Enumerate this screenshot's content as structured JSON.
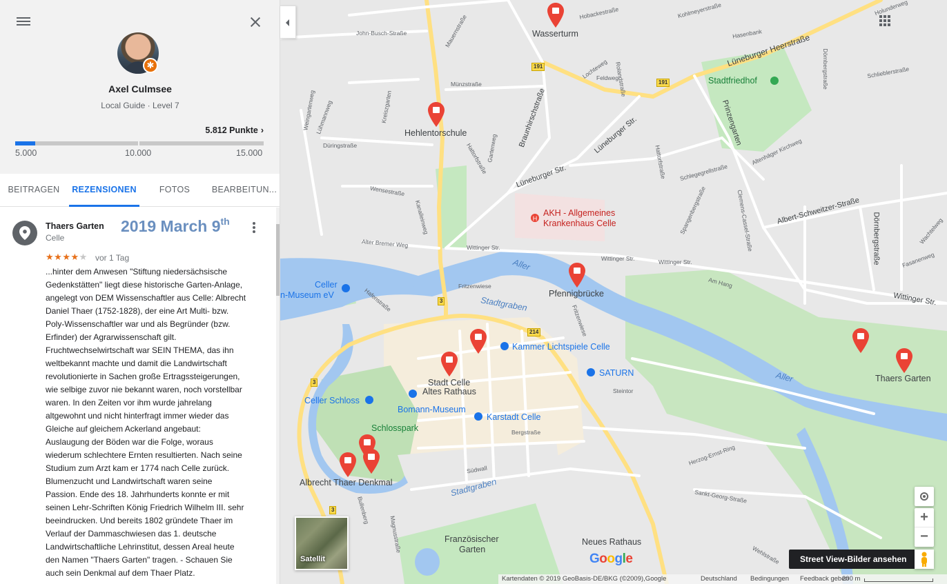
{
  "profile": {
    "name": "Axel Culmsee",
    "level": "Local Guide · Level 7",
    "points": "5.812 Punkte",
    "progress_fraction": 0.08,
    "ticks": [
      "5.000",
      "10.000",
      "15.000"
    ]
  },
  "tabs": [
    "BEITRAGEN",
    "REZENSIONEN",
    "FOTOS",
    "BEARBEITUN..."
  ],
  "review": {
    "place": "Thaers Garten",
    "city": "Celle",
    "date_overlay": "2019 March 9",
    "date_suffix": "th",
    "rating": 4,
    "max_rating": 5,
    "time": "vor 1 Tag",
    "lines": [
      "...hinter dem Anwesen \"Stiftung niedersächsische",
      "Gedenkstätten\" liegt diese historische Garten-Anlage,",
      "angelegt von DEM Wissenschaftler aus Celle: Albrecht",
      "Daniel Thaer (1752-1828), der eine Art Multi- bzw.",
      "Poly-Wissenschaftler war und als Begründer (bzw.",
      "Erfinder) der Agrarwissenschaft gilt.",
      "Fruchtwechselwirtschaft war SEIN THEMA, das ihn",
      "weltbekannt machte und damit die Landwirtschaft",
      "revolutionierte in Sachen große Ertragssteigerungen,",
      "wie selbige zuvor nie bekannt waren, noch vorstellbar",
      "waren. In den Zeiten vor ihm wurde jahrelang",
      "altgewohnt und nicht hinterfragt immer wieder das",
      "Gleiche auf gleichem Ackerland angebaut:",
      "Auslaugung der Böden war die Folge, woraus",
      "wiederum schlechtere Ernten resultierten. Nach seine",
      "Studium zum Arzt  kam er 1774 nach Celle zurück.",
      "Blumenzucht und Landwirtschaft waren seine",
      "Passion. Ende des 18. Jahrhunderts konnte er mit",
      "seinen Lehr-Schriften König Friedrich Wilhelm III. sehr",
      "beeindrucken. Und bereits 1802 gründete Thaer im",
      "Verlauf der Dammaschwiesen das 1. deutsche",
      "Landwirtschaftliche Lehrinstitut, dessen Areal heute",
      "den Namen \"Thaers Garten\" tragen. - Schauen Sie",
      "auch sein Denkmal auf dem Thaer Platz."
    ]
  },
  "map": {
    "streets": [
      "John-Busch-Straße",
      "Hobackestraße",
      "Kohlmeyerstraße",
      "Hasenbank",
      "Holunderweg",
      "Lüneburger Heerstraße",
      "Dörnbergstraße",
      "Schlieblerstraße",
      "Münzstraße",
      "Braunhirschstraße",
      "Lochteweg",
      "Rolandstraße",
      "Feldweg",
      "Lüneburger Str.",
      "Lüneburger Str.",
      "Prinzengarten",
      "Altenhäger Kirchweg",
      "Schlegegrellstraße",
      "Hattorfstraße",
      "Wensestraße",
      "Kanalleinweg",
      "Alter Bremer Weg",
      "Wittinger Str.",
      "Wittinger Str.",
      "Wittinger Str.",
      "Albert-Schweitzer-Straße",
      "Dörnbergstraße",
      "Am Hang",
      "Wittinger Str.",
      "Fritzenwiese",
      "Fritzenwiese",
      "Hafenstraße",
      "Steintor",
      "Bergstraße",
      "Südwall",
      "Herzog-Ernst-Ring",
      "Sankt-Georg-Straße",
      "Wehlstraße",
      "Weingartenweg",
      "Lühmannweg",
      "Kreiszgarten",
      "Düringstraße",
      "Gartenweg",
      "Mauernstraße",
      "Spangenbergstraße",
      "Clemens-Cassel-Straße",
      "Fasanenweg",
      "Wachtelweg",
      "Magnusstraße",
      "Bullenberg",
      "Hattorfstraße"
    ],
    "shields": [
      "191",
      "191",
      "3",
      "3",
      "3",
      "214"
    ],
    "pois": {
      "wasserturm": "Wasserturm",
      "hehlentor": "Hehlentorschule",
      "akh_1": "AKH - Allgemeines",
      "akh_2": "Krankenhaus Celle",
      "pfennig": "Pfennigbrücke",
      "thaers_garten": "Thaers Garten",
      "stadtfriedhof": "Stadtfriedhof",
      "celler_1": "Celler",
      "celler_2": "n-Museum eV",
      "kammer": "Kammer Lichtspiele Celle",
      "saturn": "SATURN",
      "stadt_1": "Stadt Celle",
      "stadt_2": "Altes Rathaus",
      "schloss": "Celler Schloss",
      "bomann": "Bomann-Museum",
      "karstadt": "Karstadt Celle",
      "schlosspark": "Schlosspark",
      "albrecht": "Albrecht Thaer Denkmal",
      "franz_1": "Französischer",
      "franz_2": "Garten",
      "rathaus": "Neues Rathaus"
    },
    "water": [
      "Aller",
      "Aller",
      "Stadtgraben",
      "Stadtgraben"
    ],
    "satellite_label": "Satellit",
    "streetview_tooltip": "Street View-Bilder ansehen",
    "google": [
      "G",
      "o",
      "o",
      "g",
      "l",
      "e"
    ],
    "footer": {
      "attribution": "Kartendaten © 2019 GeoBasis-DE/BKG (©2009),Google",
      "country": "Deutschland",
      "terms": "Bedingungen",
      "feedback": "Feedback geben",
      "scale": "200 m"
    },
    "zoom_in": "+",
    "zoom_out": "−"
  },
  "colors": {
    "accent": "#1a73e8",
    "star": "#e7711b",
    "pin": "#ea4335",
    "date_overlay": "#6a8fbf"
  }
}
